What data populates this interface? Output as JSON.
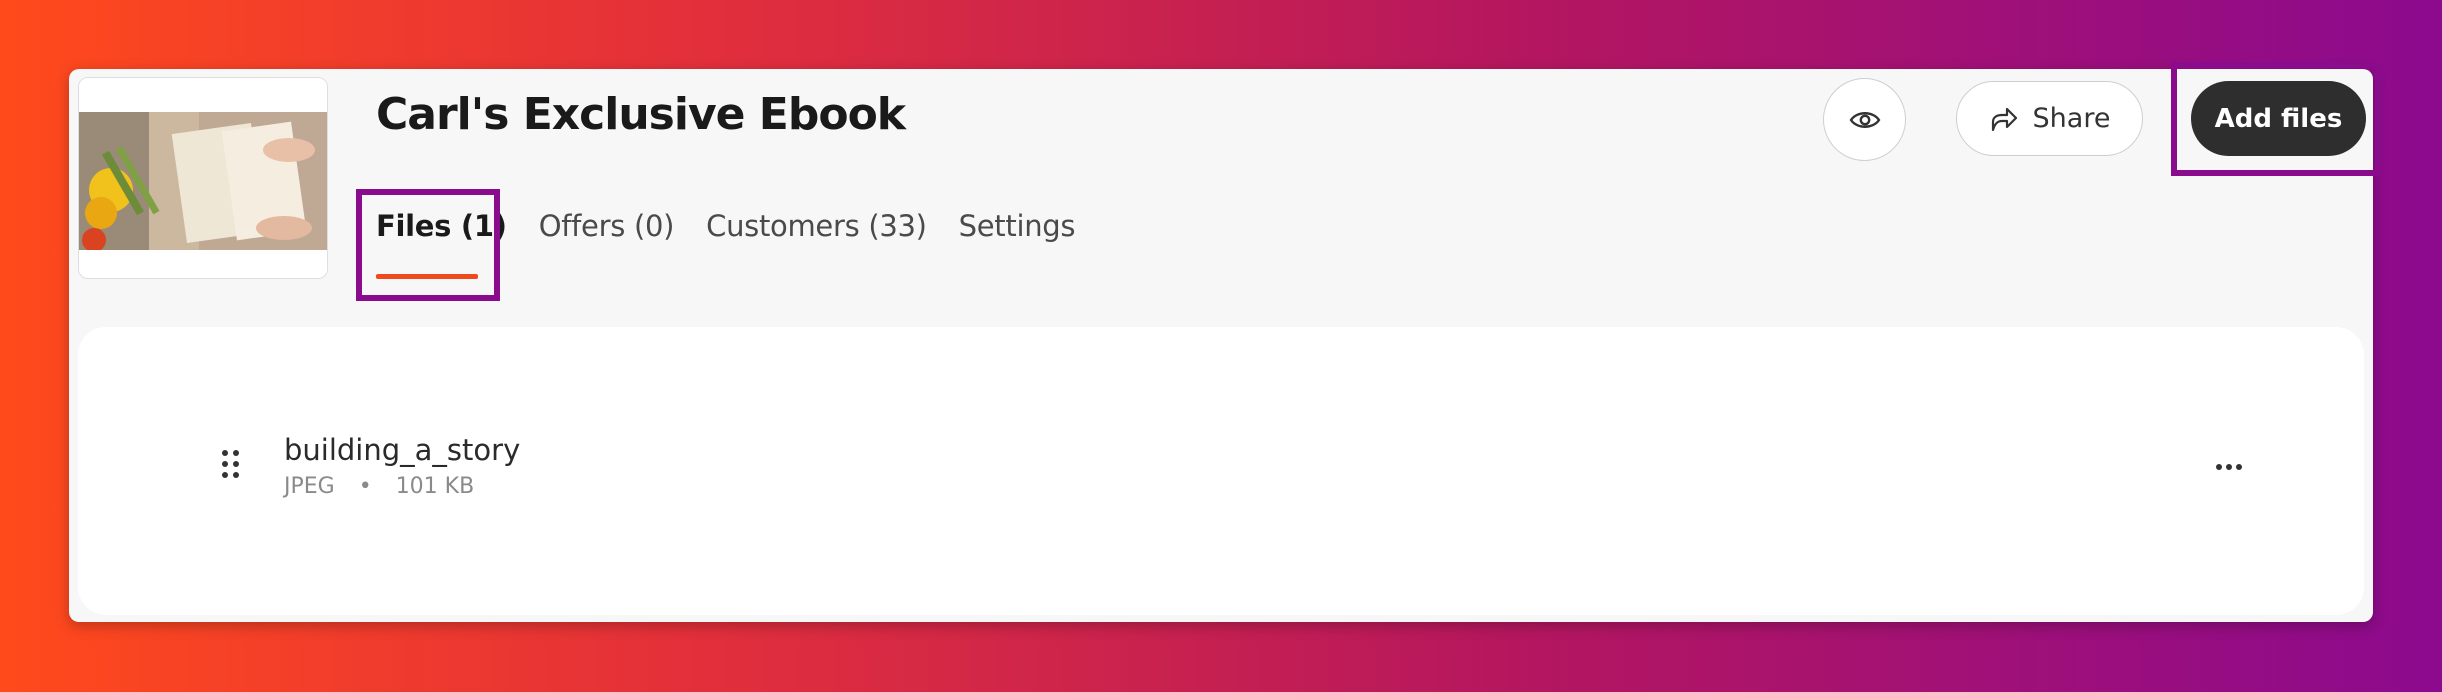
{
  "product": {
    "title": "Carl's Exclusive Ebook"
  },
  "tabs": [
    {
      "label": "Files (1)",
      "active": true
    },
    {
      "label": "Offers (0)",
      "active": false
    },
    {
      "label": "Customers (33)",
      "active": false
    },
    {
      "label": "Settings",
      "active": false
    }
  ],
  "header_actions": {
    "preview_icon": "eye-icon",
    "share_label": "Share",
    "share_icon": "share-arrow-icon",
    "add_files_label": "Add files"
  },
  "files": [
    {
      "name": "building_a_story",
      "type": "JPEG",
      "separator": "•",
      "size": "101 KB"
    }
  ],
  "colors": {
    "accent_underline": "#f04a1c",
    "highlight_box": "#8a0c8c",
    "primary_button": "#2e2e2e"
  }
}
